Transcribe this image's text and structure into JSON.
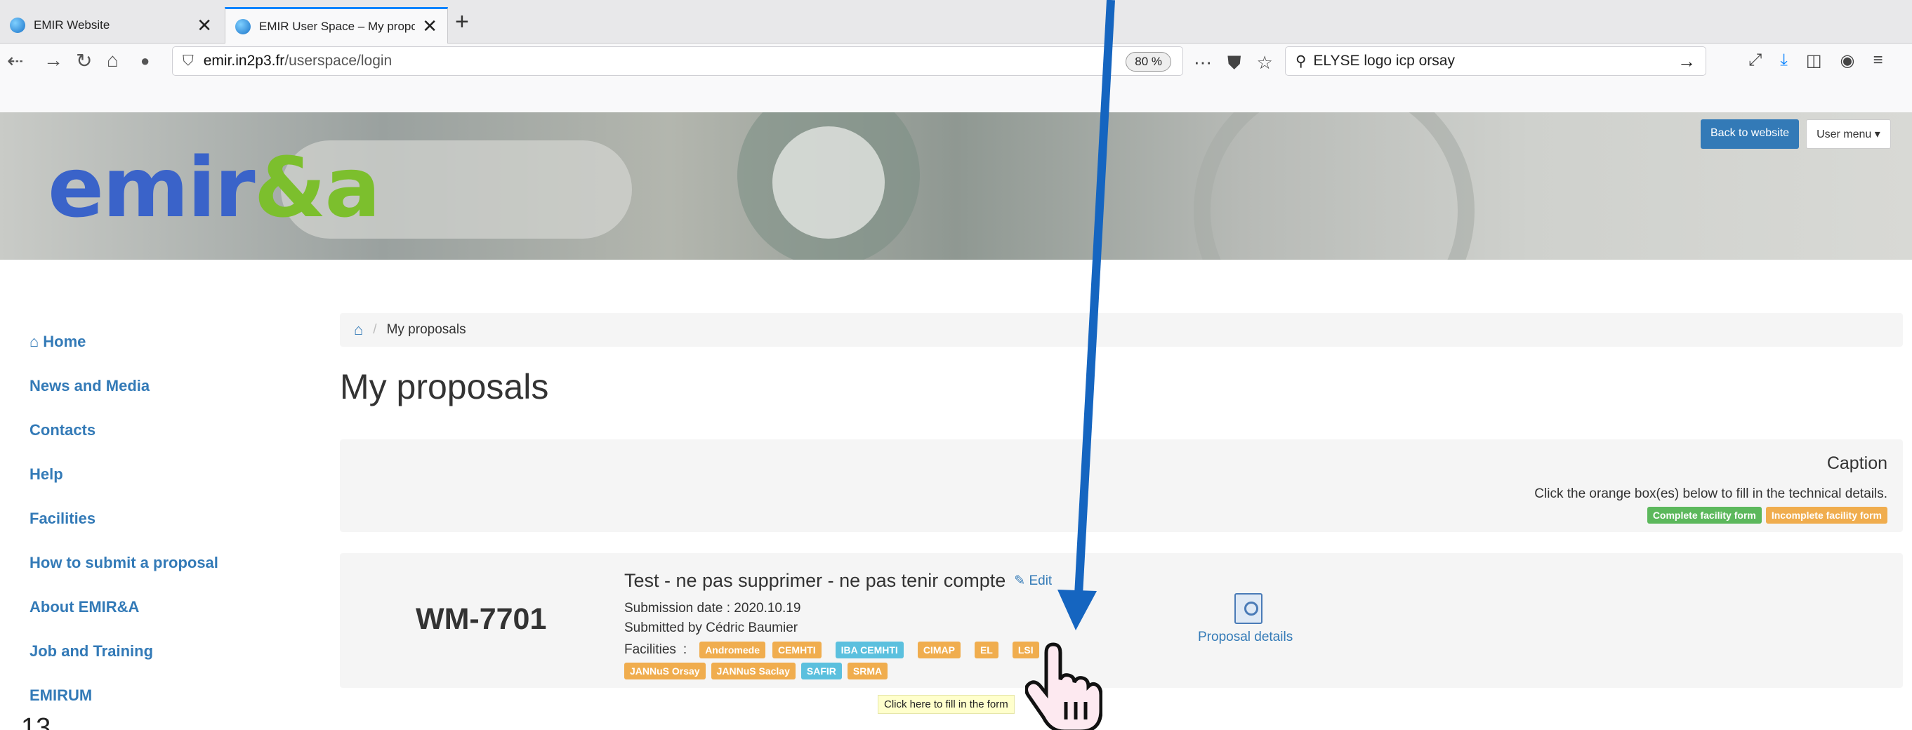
{
  "browser": {
    "tabs": [
      {
        "label": "EMIR Website",
        "close": "✕"
      },
      {
        "label": "EMIR User Space – My proposal",
        "close": "✕"
      }
    ],
    "new_tab": "+",
    "url_domain": "emir.in2p3.fr",
    "url_path": "/userspace/login",
    "zoom": "80 %",
    "search_value": "ELYSE logo icp orsay"
  },
  "header": {
    "logo_part1": "emir",
    "logo_part2": "&a",
    "back_button": "Back to website",
    "user_menu": "User menu ▾"
  },
  "sidebar": {
    "items": [
      {
        "label": "Home"
      },
      {
        "label": "News and Media"
      },
      {
        "label": "Contacts"
      },
      {
        "label": "Help"
      },
      {
        "label": "Facilities"
      },
      {
        "label": "How to submit a proposal"
      },
      {
        "label": "About EMIR&A"
      },
      {
        "label": "Job and Training"
      },
      {
        "label": "EMIRUM"
      }
    ]
  },
  "breadcrumb": {
    "current": "My proposals"
  },
  "page_title": "My proposals",
  "caption": {
    "title": "Caption",
    "text": "Click the orange box(es) below to fill in the technical details.",
    "labels": {
      "complete": "Complete facility form",
      "incomplete": "Incomplete facility form"
    }
  },
  "proposal": {
    "id": "WM-7701",
    "title": "Test - ne pas supprimer - ne pas tenir compte",
    "edit": "Edit",
    "submission": "Submission date : 2020.10.19",
    "submitted_by": "Submitted by Cédric Baumier",
    "facilities_label": "Facilities",
    "facilities_sep": ":",
    "facilities_row1": [
      {
        "name": "Andromede",
        "color": "orange"
      },
      {
        "name": "CEMHTI",
        "color": "orange"
      },
      {
        "name": "IBA   CEMHTI",
        "color": "blue"
      },
      {
        "name": "CIMAP",
        "color": "orange"
      },
      {
        "name": "EL",
        "color": "orange"
      },
      {
        "name": "LSI",
        "color": "orange"
      }
    ],
    "facilities_row2": [
      {
        "name": "JANNuS Orsay",
        "color": "orange"
      },
      {
        "name": "JANNuS Saclay",
        "color": "orange"
      },
      {
        "name": "SAFIR",
        "color": "blue"
      },
      {
        "name": "SRMA",
        "color": "orange"
      }
    ],
    "details_link": "Proposal details"
  },
  "tooltip": "Click here to fill in the form",
  "page_number": "13",
  "colors": {
    "link": "#337ab7",
    "orange_label": "#f0ad4e",
    "green_label": "#5cb85c",
    "blue_label": "#5bc0de",
    "arrow": "#1565c0"
  }
}
